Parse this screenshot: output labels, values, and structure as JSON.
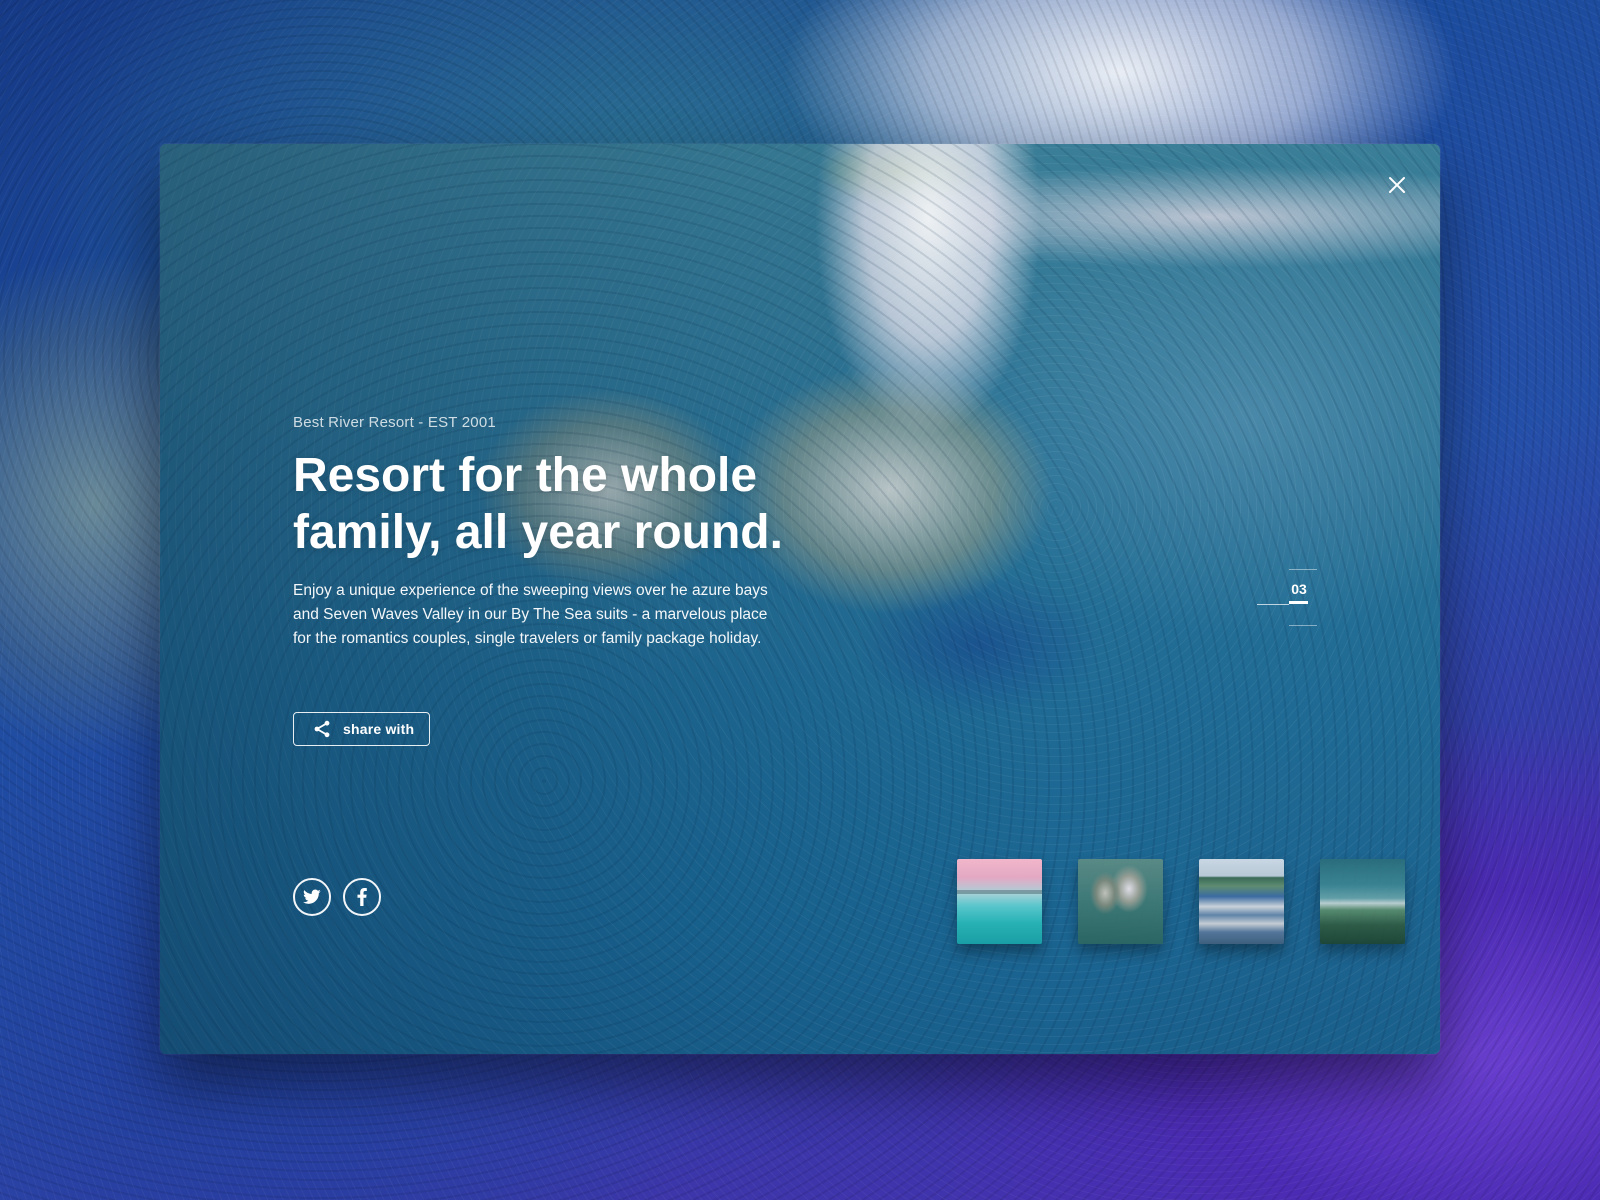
{
  "card": {
    "eyebrow": "Best River Resort - EST 2001",
    "title_lines": [
      "Resort for the whole",
      "family, all year round."
    ],
    "description_lines": [
      "Enjoy a unique experience of the sweeping views over he azure bays",
      "and Seven Waves Valley in our By The Sea suits - a marvelous place",
      "for the romantics couples, single travelers or family package holiday."
    ],
    "share_label": "share with",
    "slide_number": "03"
  },
  "icons": {
    "close": "close-icon",
    "share": "share-icon",
    "twitter": "twitter-icon",
    "facebook": "facebook-icon"
  },
  "thumbnails": [
    {
      "description": "infinity pool at sunset"
    },
    {
      "description": "aerial rock island"
    },
    {
      "description": "marina with boats"
    },
    {
      "description": "beach with palms"
    }
  ],
  "colors": {
    "text": "#ffffff",
    "ocean": "#1f6b95",
    "background_accent": "#4c2fb4"
  }
}
